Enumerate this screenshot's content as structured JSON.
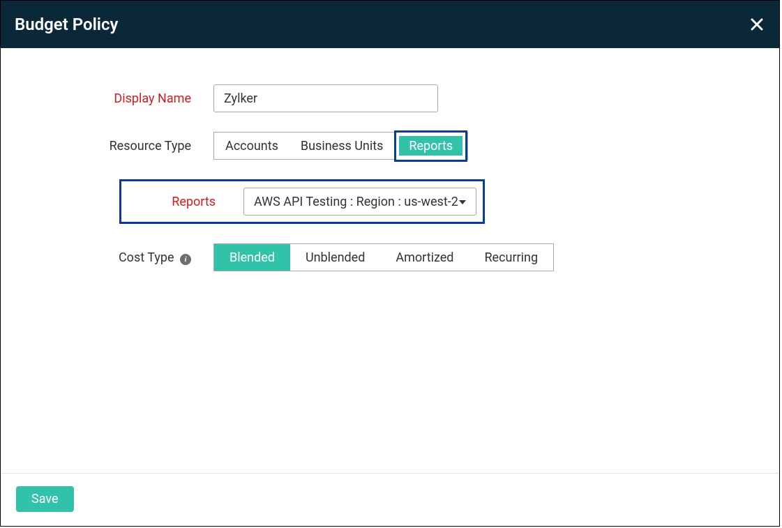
{
  "header": {
    "title": "Budget Policy"
  },
  "form": {
    "display_name": {
      "label": "Display Name",
      "value": "Zylker"
    },
    "resource_type": {
      "label": "Resource Type",
      "options": [
        "Accounts",
        "Business Units",
        "Reports"
      ],
      "selected": "Reports"
    },
    "reports": {
      "label": "Reports",
      "value": "AWS API Testing : Region : us-west-2"
    },
    "cost_type": {
      "label": "Cost Type",
      "options": [
        "Blended",
        "Unblended",
        "Amortized",
        "Recurring"
      ],
      "selected": "Blended"
    }
  },
  "footer": {
    "save_label": "Save"
  },
  "colors": {
    "header_bg": "#0b2838",
    "accent": "#32c1a9",
    "required": "#d11b1f",
    "highlight_border": "#0a3a9a"
  }
}
